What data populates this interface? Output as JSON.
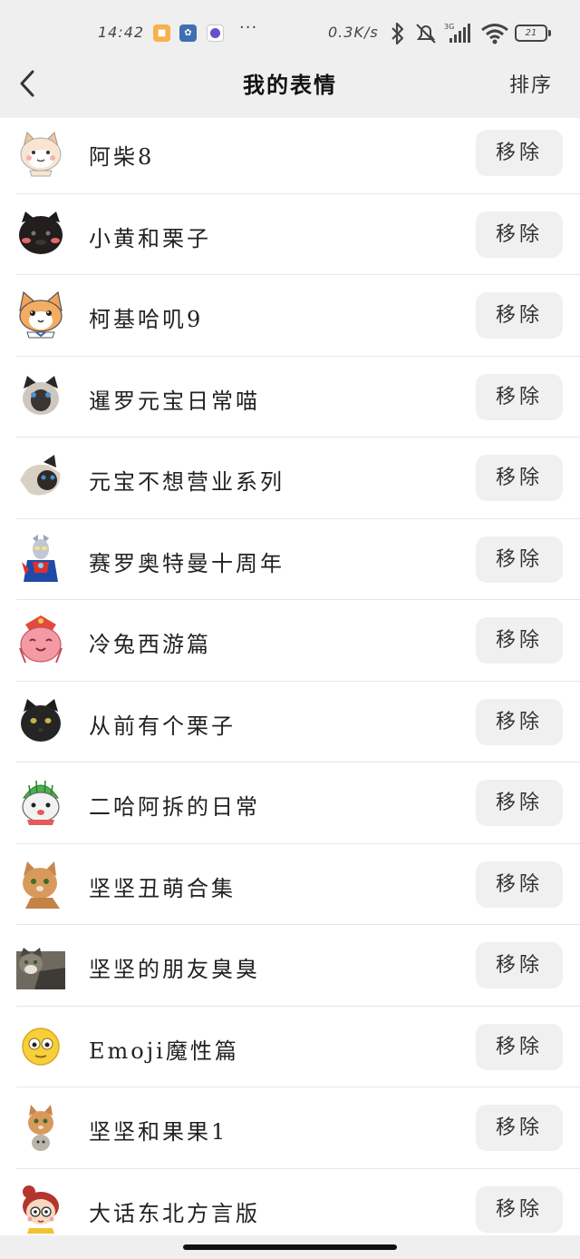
{
  "status_bar": {
    "time": "14:42",
    "more": "···",
    "net_speed": "0.3K/s",
    "battery": "21"
  },
  "nav": {
    "title": "我的表情",
    "sort_label": "排序"
  },
  "remove_label": "移除",
  "stickers": [
    {
      "name": "阿柴8",
      "icon": "shiba-dog-sticker-icon"
    },
    {
      "name": "小黄和栗子",
      "icon": "black-cat-sticker-icon"
    },
    {
      "name": "柯基哈叽9",
      "icon": "corgi-sticker-icon"
    },
    {
      "name": "暹罗元宝日常喵",
      "icon": "siamese-cat-sticker-icon"
    },
    {
      "name": "元宝不想营业系列",
      "icon": "siamese-cat-sticker-icon"
    },
    {
      "name": "赛罗奥特曼十周年",
      "icon": "ultraman-sticker-icon"
    },
    {
      "name": "冷兔西游篇",
      "icon": "pink-rabbit-sticker-icon"
    },
    {
      "name": "从前有个栗子",
      "icon": "black-cat-sticker-icon"
    },
    {
      "name": "二哈阿拆的日常",
      "icon": "husky-sticker-icon"
    },
    {
      "name": "坚坚丑萌合集",
      "icon": "orange-cat-sticker-icon"
    },
    {
      "name": "坚坚的朋友臭臭",
      "icon": "tabby-cat-sticker-icon"
    },
    {
      "name": "Emoji魔性篇",
      "icon": "emoji-face-sticker-icon"
    },
    {
      "name": "坚坚和果果1",
      "icon": "orange-cat-sticker-icon"
    },
    {
      "name": "大话东北方言版",
      "icon": "girl-cartoon-sticker-icon"
    }
  ]
}
